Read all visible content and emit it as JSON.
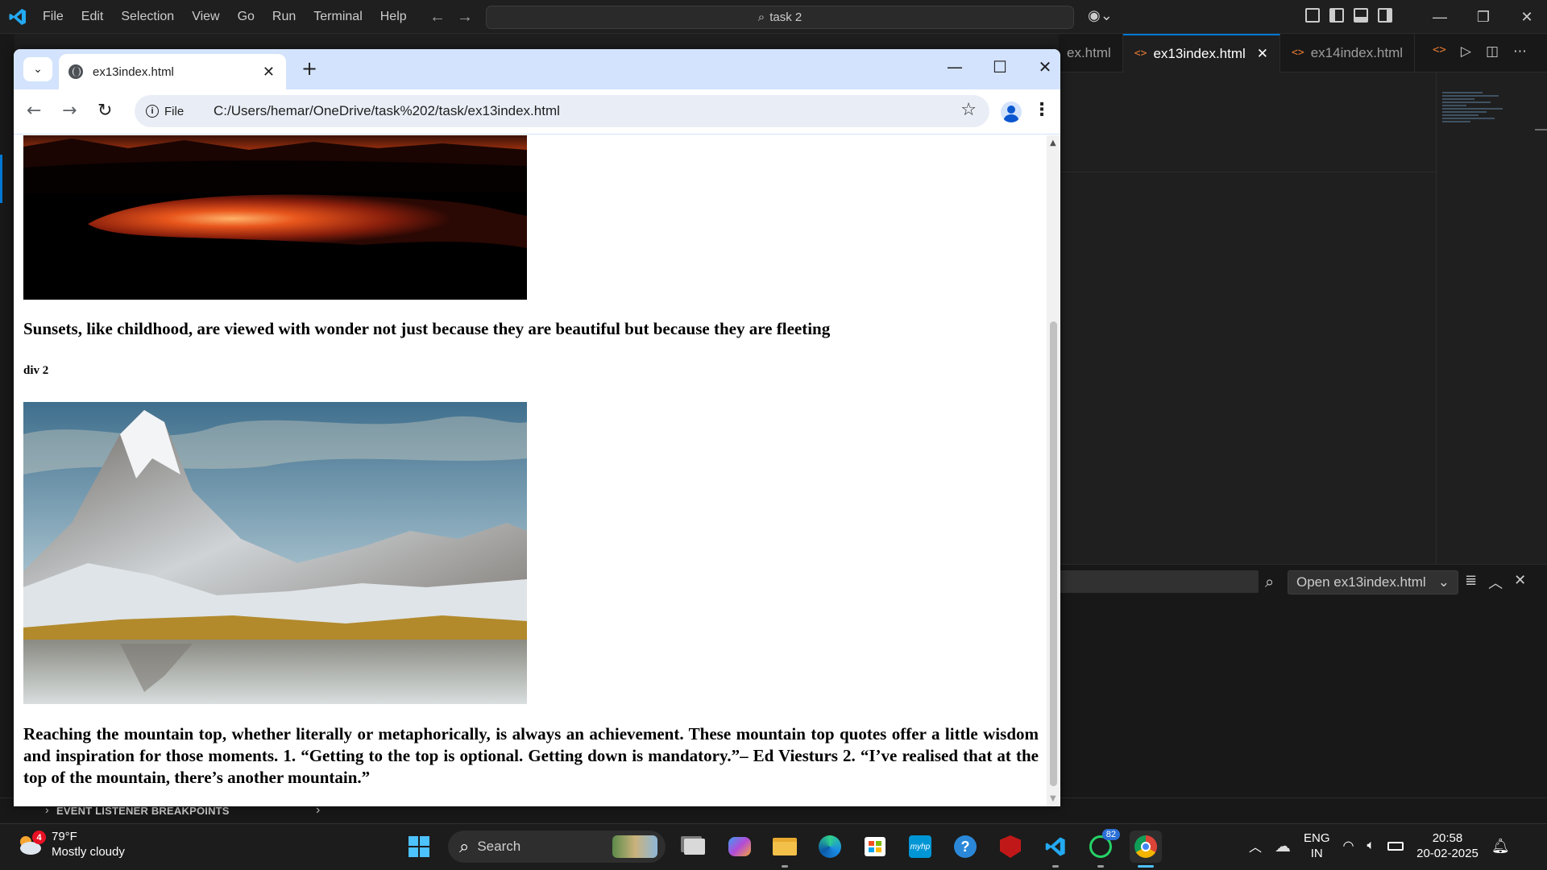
{
  "vscode": {
    "menu": [
      "File",
      "Edit",
      "Selection",
      "View",
      "Go",
      "Run",
      "Terminal",
      "Help"
    ],
    "command_center": "task 2",
    "tabs": [
      {
        "label": "ex.html",
        "active": false
      },
      {
        "label": "ex13index.html",
        "active": true
      },
      {
        "label": "ex14index.html",
        "active": false
      }
    ],
    "panel_select": "Open ex13index.html",
    "breakpoints_label": "EVENT LISTENER BREAKPOINTS",
    "accent": "#0078d4"
  },
  "chrome": {
    "tab_title": "ex13index.html",
    "omnibox_chip": "File",
    "url": "C:/Users/hemar/OneDrive/task%202/task/ex13index.html",
    "accent": "#d3e3fd"
  },
  "page": {
    "quote1": "Sunsets, like childhood, are viewed with wonder not just because they are beautiful but because they are fleeting",
    "div2_label": "div 2",
    "quote2": "Reaching the mountain top, whether literally or metaphorically, is always an achievement. These mountain top quotes offer a little wisdom and inspiration for those moments. 1. “Getting to the top is optional. Getting down is mandatory.”– Ed Viesturs 2. “I’ve realised that at the top of the mountain, there’s another mountain.”"
  },
  "taskbar": {
    "weather_temp": "79°F",
    "weather_desc": "Mostly cloudy",
    "weather_badge": "4",
    "search_label": "Search",
    "whatsapp_badge": "82",
    "lang_line1": "ENG",
    "lang_line2": "IN",
    "time": "20:58",
    "date": "20-02-2025"
  }
}
